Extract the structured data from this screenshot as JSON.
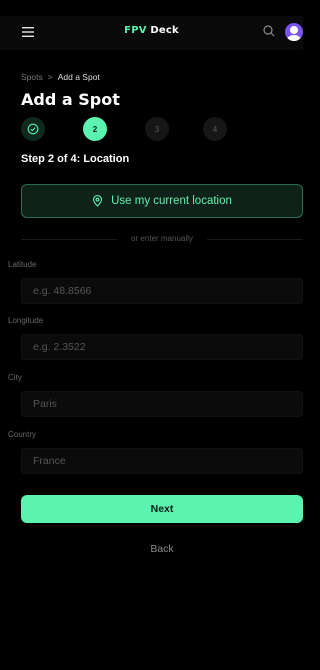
{
  "app_bar": {
    "brand_accent": "FPV",
    "brand_rest": " Deck",
    "icons": {
      "menu": "hamburger-menu-icon",
      "search": "search-icon",
      "avatar": "user-avatar-icon"
    }
  },
  "breadcrumb": {
    "parent": "Spots",
    "separator": ">",
    "current": "Add a Spot"
  },
  "page": {
    "title": "Add a Spot"
  },
  "stepper": {
    "steps": [
      {
        "label": "✓",
        "state": "done"
      },
      {
        "label": "2",
        "state": "active"
      },
      {
        "label": "3",
        "state": "pending"
      },
      {
        "label": "4",
        "state": "pending"
      }
    ],
    "current_label": "Step 2 of 4: Location"
  },
  "location_button": {
    "label": "Use my current location",
    "icon": "map-pin-icon"
  },
  "divider_text": "or enter manually",
  "fields": [
    {
      "label": "Latitude",
      "placeholder": "e.g. 48.8566"
    },
    {
      "label": "Longitude",
      "placeholder": "e.g. 2.3522"
    },
    {
      "label": "City",
      "placeholder": "Paris"
    },
    {
      "label": "Country",
      "placeholder": "France"
    }
  ],
  "actions": {
    "next": "Next",
    "back": "Back"
  },
  "colors": {
    "accent": "#5cf2b0",
    "background": "#000000",
    "avatar": "#7b55f0"
  }
}
